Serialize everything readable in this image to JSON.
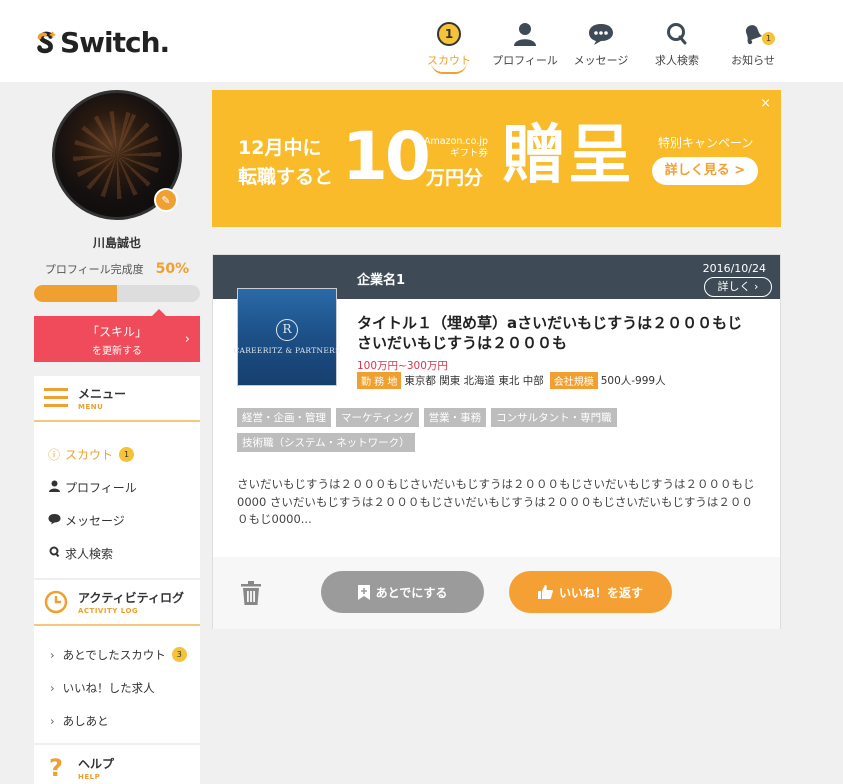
{
  "brand": {
    "logo_text": "Switch."
  },
  "nav": [
    {
      "label": "スカウト",
      "icon": "scout-badge-icon",
      "badge": "1",
      "active": true
    },
    {
      "label": "プロフィール",
      "icon": "person-icon"
    },
    {
      "label": "メッセージ",
      "icon": "chat-icon"
    },
    {
      "label": "求人検索",
      "icon": "search-icon"
    },
    {
      "label": "お知らせ",
      "icon": "bell-icon",
      "badge": "1"
    }
  ],
  "profile": {
    "name": "川島誠也",
    "completion_label": "プロフィール完成度",
    "completion_value": "50%",
    "completion_fraction": 0.5
  },
  "skill_cta": {
    "title": "「スキル」",
    "subtitle": "を更新する"
  },
  "menu": {
    "title": "メニュー",
    "title_en": "MENU",
    "items": [
      {
        "label": "スカウト",
        "badge": "1"
      },
      {
        "label": "プロフィール"
      },
      {
        "label": "メッセージ"
      },
      {
        "label": "求人検索"
      }
    ]
  },
  "activity": {
    "title": "アクティビティログ",
    "title_en": "ACTIVITY LOG",
    "items": [
      {
        "label": "あとでしたスカウト",
        "badge": "3"
      },
      {
        "label": "いいね！した求人"
      },
      {
        "label": "あしあと"
      }
    ]
  },
  "help": {
    "title": "ヘルプ",
    "title_en": "HELP"
  },
  "banner": {
    "line1": "12月中に",
    "line2": "転職すると",
    "big_number": "10",
    "amazon_line1": "Amazon.co.jp",
    "amazon_line2": "ギフト券",
    "unit": "万円分",
    "gift": "贈呈",
    "campaign": "特別キャンペーン",
    "more_button": "詳しく見る >",
    "close": "×"
  },
  "job": {
    "company": "企業名1",
    "date": "2016/10/24",
    "detail_button": "詳しく",
    "logo_text": "CAREERITZ & PARTNERS",
    "title": "タイトル１（埋め草）aさいだいもじすうは２０００もじさいだいもじすうは２０００も",
    "salary": "100万円~300万円",
    "location_label": "勤 務 地",
    "location_value": "東京都 関東 北海道 東北 中部",
    "size_label": "会社規模",
    "size_value": "500人-999人",
    "tags": [
      "経営・企画・管理",
      "マーケティング",
      "営業・事務",
      "コンサルタント・専門職",
      "技術職（システム・ネットワーク）"
    ],
    "description": "さいだいもじすうは２０００もじさいだいもじすうは２０００もじさいだいもじすうは２０００もじ0000 さいだいもじすうは２０００もじさいだいもじすうは２０００もじさいだいもじすうは２０００もじ0000...",
    "later_button": "あとでにする",
    "like_button": "いいね！を返す"
  },
  "colors": {
    "accent": "#f0a030",
    "danger": "#f04b5a",
    "header_dark": "#3e4b56",
    "banner": "#f9bb2a"
  }
}
